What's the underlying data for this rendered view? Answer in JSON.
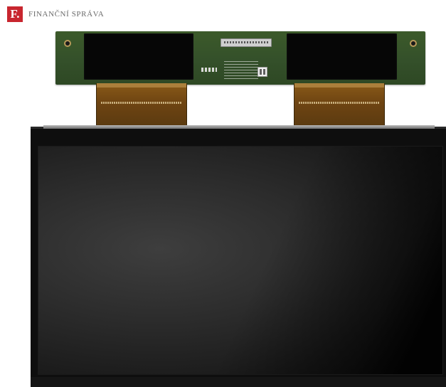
{
  "watermark": {
    "logo_letter": "F.",
    "brand_text": "FINANČNÍ SPRÁVA"
  },
  "colors": {
    "logo": "#c8262f",
    "pcb": "#34502a",
    "flex_cable": "#6e4412",
    "panel": "#0e0e0e"
  },
  "photo": {
    "subject_icon": "lcd-panel-with-driver-board-image"
  }
}
